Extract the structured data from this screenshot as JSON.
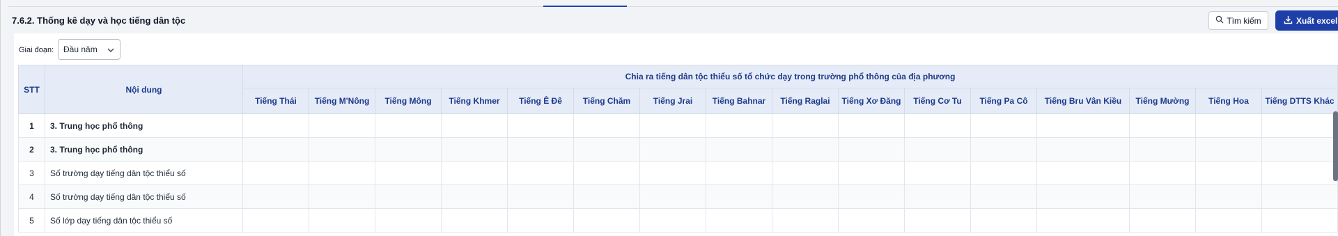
{
  "section_title": "7.6.2. Thống kê dạy và học tiếng dân tộc",
  "buttons": {
    "search": "Tìm kiếm",
    "export": "Xuất excel"
  },
  "filter": {
    "label": "Giai đoạn:",
    "value": "Đầu năm"
  },
  "table": {
    "col_stt": "STT",
    "col_content": "Nội dung",
    "group_header": "Chia ra tiếng dân tộc thiểu số tổ chức dạy trong trường phổ thông của địa phương",
    "languages": [
      "Tiếng Thái",
      "Tiếng M'Nông",
      "Tiếng Mông",
      "Tiếng Khmer",
      "Tiếng Ê Đê",
      "Tiếng Chăm",
      "Tiếng Jrai",
      "Tiếng Bahnar",
      "Tiếng Raglai",
      "Tiếng Xơ Đăng",
      "Tiếng Cơ Tu",
      "Tiếng Pa Cô",
      "Tiếng Bru Vân Kiều",
      "Tiếng Mường",
      "Tiếng Hoa",
      "Tiếng DTTS Khác"
    ],
    "rows": [
      {
        "stt": "1",
        "content": "3. Trung học phổ thông",
        "bold": true
      },
      {
        "stt": "2",
        "content": "3. Trung học phổ thông",
        "bold": true
      },
      {
        "stt": "3",
        "content": "Số trường dạy tiếng dân tộc thiểu số",
        "bold": false
      },
      {
        "stt": "4",
        "content": "Số trường dạy tiếng dân tộc thiểu số",
        "bold": false
      },
      {
        "stt": "5",
        "content": "Số lớp dạy tiếng dân tộc thiểu số",
        "bold": false
      }
    ]
  }
}
